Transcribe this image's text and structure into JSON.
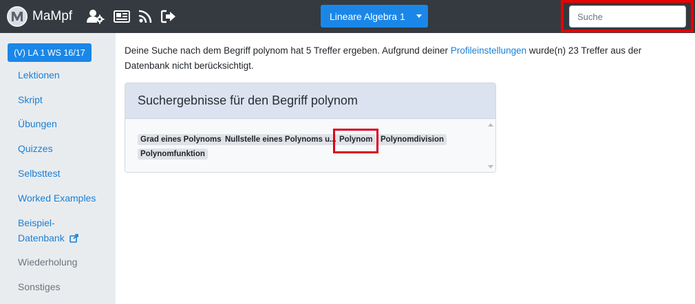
{
  "navbar": {
    "brand": "MaMpf",
    "icons": [
      "user-gear-icon",
      "news-icon",
      "feed-icon",
      "logout-icon"
    ],
    "course_button": "Lineare Algebra 1",
    "search": {
      "placeholder": "Suche",
      "value": ""
    }
  },
  "sidebar": {
    "active": "(V) LA 1 WS 16/17",
    "items": [
      {
        "label": "Lektionen"
      },
      {
        "label": "Skript"
      },
      {
        "label": "Übungen"
      },
      {
        "label": "Quizzes"
      },
      {
        "label": "Selbsttest"
      },
      {
        "label": "Worked Examples"
      },
      {
        "label_line1": "Beispiel-",
        "label_line2": "Datenbank"
      },
      {
        "label": "Wiederholung"
      },
      {
        "label": "Sonstiges"
      }
    ]
  },
  "main": {
    "intro_before": "Deine Suche nach dem Begriff polynom hat 5 Treffer ergeben. Aufgrund deiner ",
    "intro_link": "Profileinstellungen",
    "intro_after": " wurde(n) 23 Treffer aus der Datenbank nicht berücksichtigt.",
    "card_title": "Suchergebnisse für den Begriff polynom",
    "tags": [
      "Grad eines Polynoms",
      "Nullstelle eines Polynoms u...",
      "Polynom",
      "Polynomdivision",
      "Polynomfunktion"
    ]
  },
  "colors": {
    "navbar": "#343a40",
    "accent": "#1a87e8",
    "link": "#1a7fd5",
    "highlight": "#ea0000"
  }
}
